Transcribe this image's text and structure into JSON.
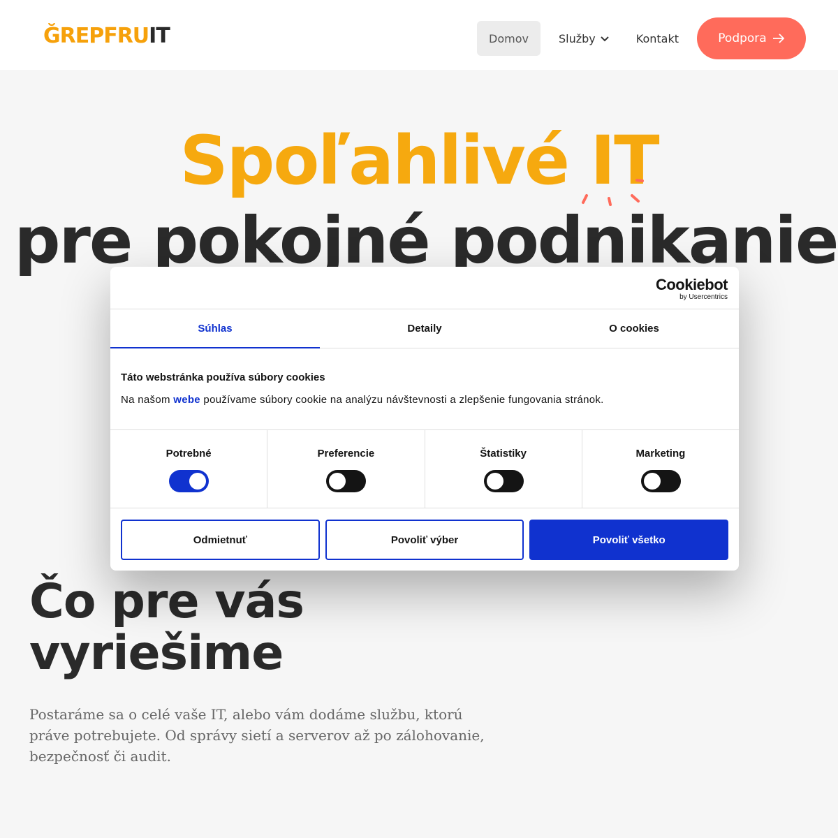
{
  "header": {
    "logo_part1": "ĞREPFRU",
    "logo_part2": "IT",
    "nav": {
      "home": "Domov",
      "services": "Služby",
      "contact": "Kontakt",
      "cta": "Podpora"
    }
  },
  "hero": {
    "line1": "Spoľahlivé IT",
    "line2": "pre pokojné podnikanie"
  },
  "section": {
    "title_line1": "Čo pre vás",
    "title_line2": "vyriešime",
    "text": "Postaráme sa o celé vaše IT, alebo vám dodáme službu, ktorú práve potrebujete. Od správy sietí a serverov až po zálohovanie, bezpečnosť či audit."
  },
  "cookie": {
    "brand": "Cookiebot",
    "brand_sub": "by Usercentrics",
    "tabs": [
      "Súhlas",
      "Detaily",
      "O cookies"
    ],
    "title": "Táto webstránka používa súbory cookies",
    "text_before": "Na našom ",
    "text_link": "webe",
    "text_after": " používame súbory cookie na analýzu návštevnosti a zlepšenie fungovania stránok.",
    "toggles": [
      {
        "label": "Potrebné",
        "on": true
      },
      {
        "label": "Preferencie",
        "on": false
      },
      {
        "label": "Štatistiky",
        "on": false
      },
      {
        "label": "Marketing",
        "on": false
      }
    ],
    "buttons": {
      "deny": "Odmietnuť",
      "allow_selection": "Povoliť výber",
      "allow_all": "Povoliť všetko"
    }
  },
  "colors": {
    "brand_orange": "#f6a90f",
    "cta_coral": "#ff6b5b",
    "cookie_blue": "#1032cf"
  }
}
